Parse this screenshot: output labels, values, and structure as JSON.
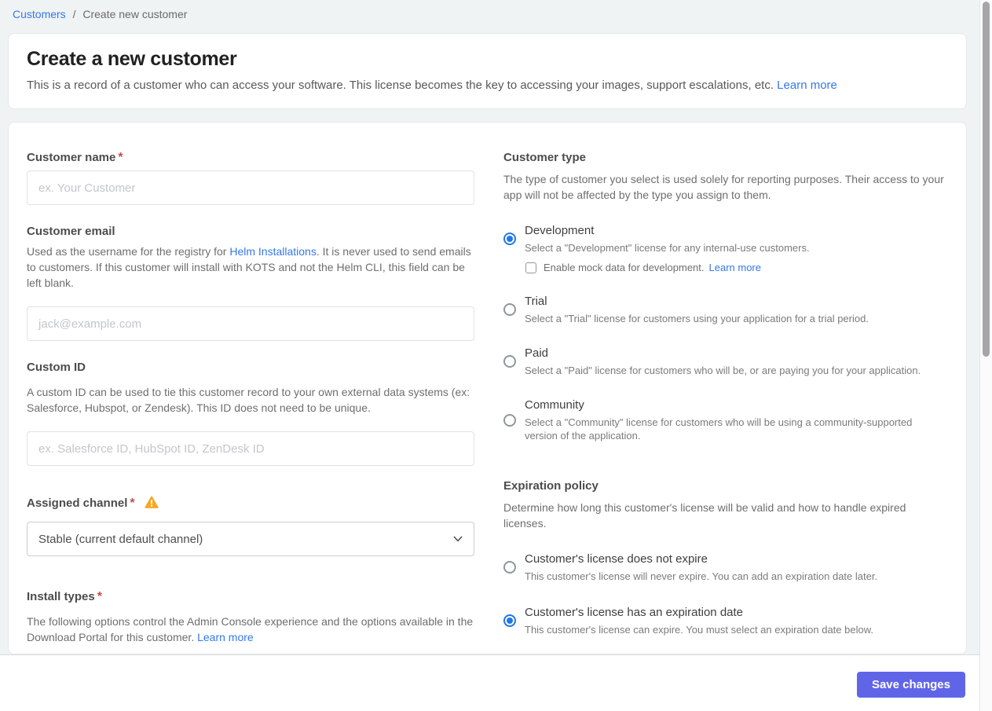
{
  "breadcrumb": {
    "root": "Customers",
    "separator": "/",
    "current": "Create new customer"
  },
  "header": {
    "title": "Create a new customer",
    "description": "This is a record of a customer who can access your software. This license becomes the key to accessing your images, support escalations, etc.",
    "learn_more": "Learn more"
  },
  "form": {
    "customer_name": {
      "label": "Customer name",
      "required": "*",
      "value": "",
      "placeholder": "ex. Your Customer"
    },
    "customer_email": {
      "label": "Customer email",
      "description_before_link": "Used as the username for the registry for ",
      "link": "Helm Installations",
      "description_after_link": ". It is never used to send emails to customers. If this customer will install with KOTS and not the Helm CLI, this field can be left blank.",
      "value": "",
      "placeholder": "jack@example.com"
    },
    "custom_id": {
      "label": "Custom ID",
      "description": "A custom ID can be used to tie this customer record to your own external data systems (ex: Salesforce, Hubspot, or Zendesk). This ID does not need to be unique.",
      "value": "",
      "placeholder": "ex. Salesforce ID, HubSpot ID, ZenDesk ID"
    },
    "assigned_channel": {
      "label": "Assigned channel",
      "required": "*",
      "warning_icon": "warning-triangle",
      "selected_option": "Stable (current default channel)"
    },
    "install_types": {
      "label": "Install types",
      "required": "*",
      "description": "The following options control the Admin Console experience and the options available in the Download Portal for this customer.",
      "learn_more": "Learn more"
    },
    "customer_type": {
      "label": "Customer type",
      "description": "The type of customer you select is used solely for reporting purposes. Their access to your app will not be affected by the type you assign to them.",
      "options": [
        {
          "label": "Development",
          "description": "Select a \"Development\" license for any internal-use customers.",
          "selected": true,
          "mock_data": {
            "checkbox_label": "Enable mock data for development.",
            "learn_more": "Learn more",
            "checked": false
          }
        },
        {
          "label": "Trial",
          "description": "Select a \"Trial\" license for customers using your application for a trial period.",
          "selected": false
        },
        {
          "label": "Paid",
          "description": "Select a \"Paid\" license for customers who will be, or are paying you for your application.",
          "selected": false
        },
        {
          "label": "Community",
          "description": "Select a \"Community\" license for customers who will be using a community-supported version of the application.",
          "selected": false
        }
      ]
    },
    "expiration_policy": {
      "label": "Expiration policy",
      "description": "Determine how long this customer's license will be valid and how to handle expired licenses.",
      "options": [
        {
          "label": "Customer's license does not expire",
          "description": "This customer's license will never expire. You can add an expiration date later.",
          "selected": false
        },
        {
          "label": "Customer's license has an expiration date",
          "description": "This customer's license can expire. You must select an expiration date below.",
          "selected": true
        }
      ]
    }
  },
  "footer": {
    "save_label": "Save changes"
  },
  "colors": {
    "link_blue": "#3478e9",
    "radio_selected_blue": "#2077e8",
    "save_button_indigo": "#6065e8",
    "warning_amber": "#f7a829",
    "required_red": "#c64a4a",
    "page_background": "#eff3f4"
  }
}
